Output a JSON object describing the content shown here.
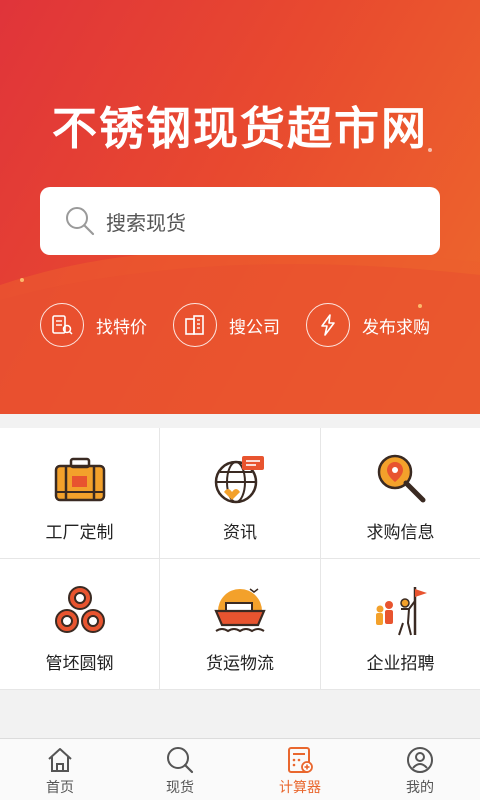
{
  "hero": {
    "title": "不锈钢现货超市网",
    "search_placeholder": "搜索现货"
  },
  "quick_links": [
    {
      "label": "找特价",
      "icon": "price-tag-list-icon"
    },
    {
      "label": "搜公司",
      "icon": "company-building-icon"
    },
    {
      "label": "发布求购",
      "icon": "lightning-icon"
    }
  ],
  "grid": [
    {
      "label": "工厂定制",
      "icon": "suitcase-icon"
    },
    {
      "label": "资讯",
      "icon": "globe-chat-icon"
    },
    {
      "label": "求购信息",
      "icon": "location-search-icon"
    },
    {
      "label": "管坯圆钢",
      "icon": "pipe-stack-icon"
    },
    {
      "label": "货运物流",
      "icon": "cargo-ship-icon"
    },
    {
      "label": "企业招聘",
      "icon": "recruit-people-icon"
    }
  ],
  "tabs": [
    {
      "label": "首页",
      "icon": "home-icon",
      "active": false
    },
    {
      "label": "现货",
      "icon": "search-icon",
      "active": false
    },
    {
      "label": "计算器",
      "icon": "calculator-icon",
      "active": true
    },
    {
      "label": "我的",
      "icon": "user-icon",
      "active": false
    }
  ],
  "colors": {
    "hero_start": "#e0343a",
    "hero_end": "#ee6a2c",
    "accent": "#e9672e",
    "icon_orange": "#f3a12b",
    "icon_red": "#e8542f"
  }
}
